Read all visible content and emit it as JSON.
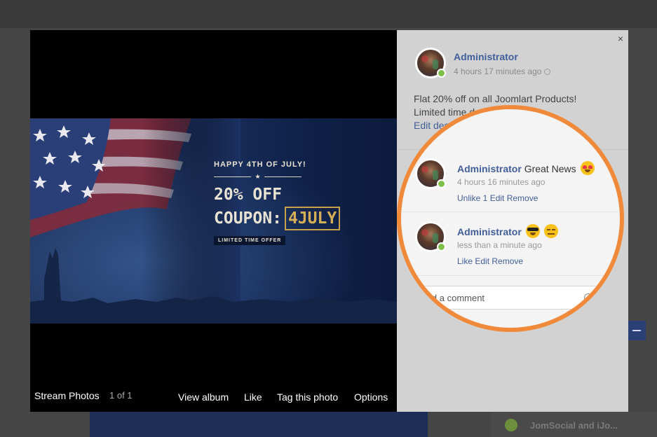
{
  "background": {
    "sidebar_item": "JomSocial and iJo..."
  },
  "photo": {
    "promo": {
      "happy": "HAPPY 4TH OF JULY!",
      "star": "★",
      "off": "20% OFF",
      "coupon_label": "COUPON:",
      "coupon_code": "4JULY",
      "badge": "LIMITED TIME OFFER"
    },
    "footer": {
      "album": "Stream Photos",
      "count": "1 of 1",
      "actions": [
        "View album",
        "Like",
        "Tag this photo",
        "Options"
      ]
    }
  },
  "panel": {
    "close": "×",
    "post": {
      "author": "Administrator",
      "time": "4 hours 17 minutes ago",
      "desc_line1": "Flat 20% off on all Joomlart Products!",
      "desc_line2": "Limited time deal",
      "edit": "Edit description"
    },
    "comments": [
      {
        "author": "Administrator",
        "text": "Great News",
        "emoji": "heart-eyes-emoji",
        "time": "4 hours 16 minutes ago",
        "actions": "Unlike 1 Edit Remove"
      },
      {
        "author": "Administrator",
        "text": "",
        "emoji": "sunglasses-emoji, expressionless-emoji",
        "time": "less than a minute ago",
        "actions": "Like Edit Remove"
      }
    ],
    "add_comment_placeholder": "Add a comment"
  },
  "colors": {
    "accent_orange": "#f08a3a",
    "link_blue": "#415e99",
    "online_green": "#7ec04a",
    "coupon_gold": "#c9a14a"
  }
}
